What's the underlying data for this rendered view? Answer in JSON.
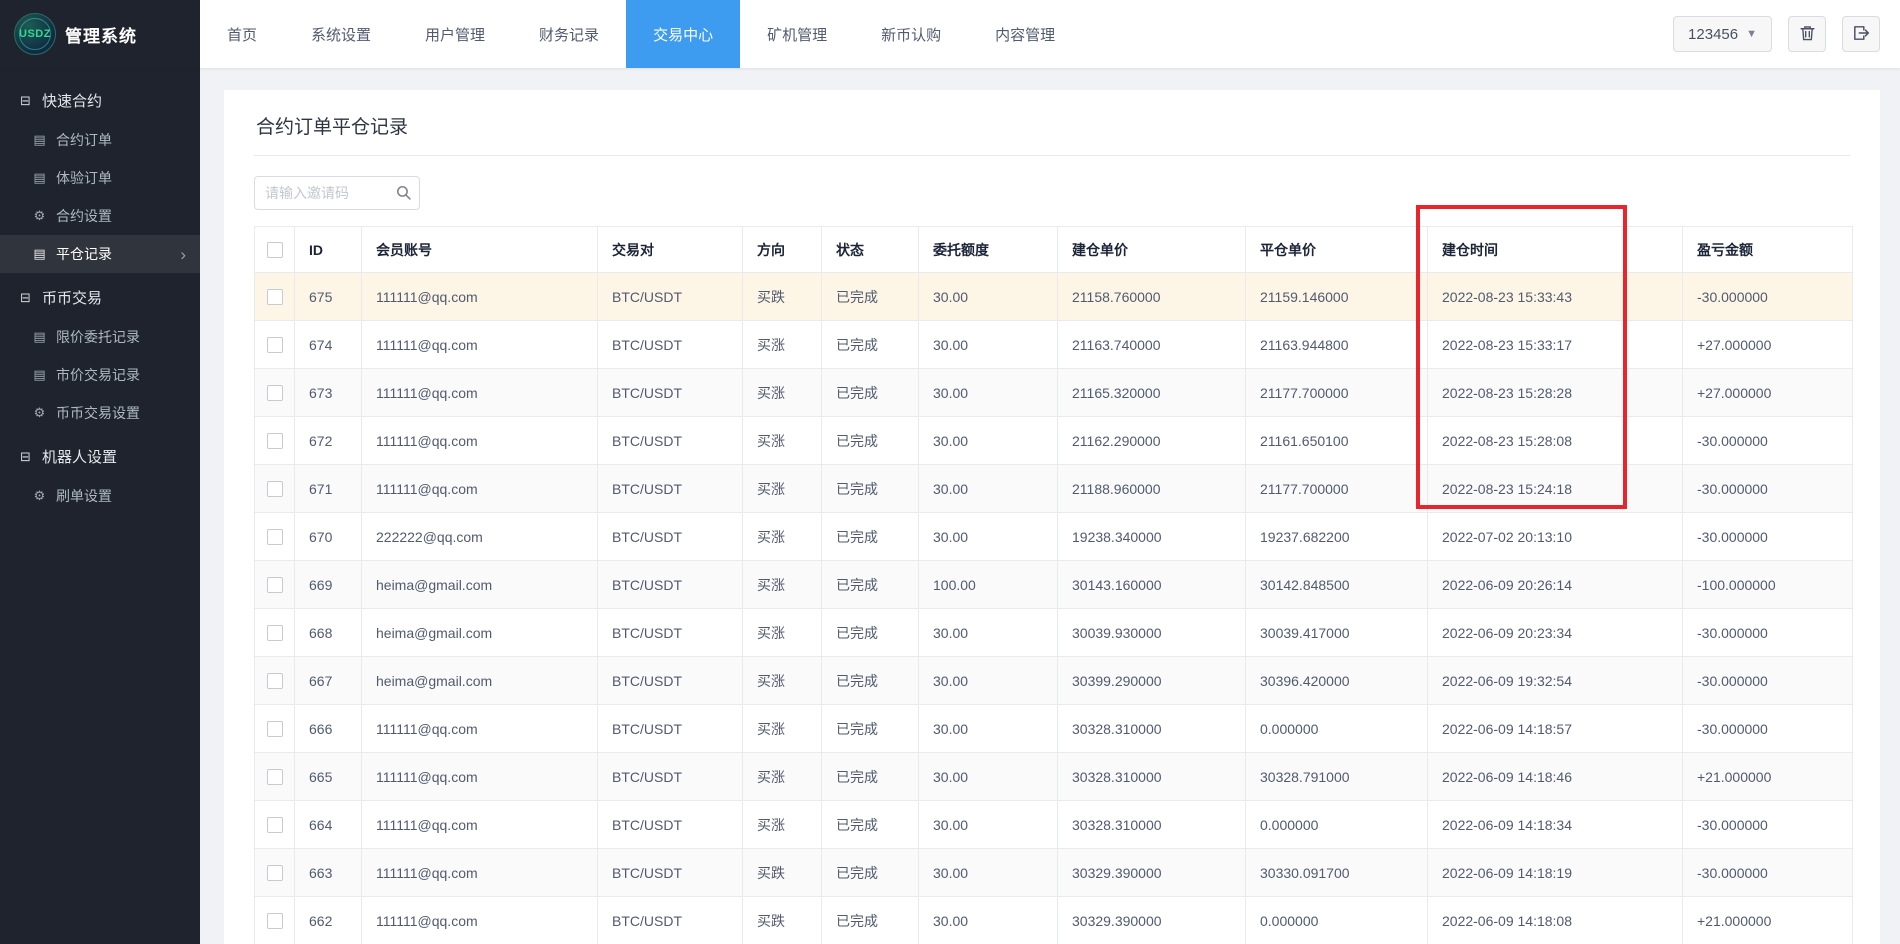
{
  "colors": {
    "accent": "#3d9bf0",
    "green": "#19be6b",
    "red": "#ed4014",
    "sidebar_bg": "#1f232d",
    "highlight_row": "#fdf6e7",
    "annotation": "#e8252c"
  },
  "brand": {
    "logo_text": "USDZ",
    "title": "管理系统"
  },
  "topnav": {
    "items": [
      {
        "label": "首页",
        "active": false
      },
      {
        "label": "系统设置",
        "active": false
      },
      {
        "label": "用户管理",
        "active": false
      },
      {
        "label": "财务记录",
        "active": false
      },
      {
        "label": "交易中心",
        "active": true
      },
      {
        "label": "矿机管理",
        "active": false
      },
      {
        "label": "新币认购",
        "active": false
      },
      {
        "label": "内容管理",
        "active": false
      }
    ],
    "user_dropdown": "123456"
  },
  "sidebar": {
    "sections": [
      {
        "title": "快速合约",
        "items": [
          {
            "label": "合约订单",
            "icon": "document-icon",
            "active": false
          },
          {
            "label": "体验订单",
            "icon": "document-icon",
            "active": false
          },
          {
            "label": "合约设置",
            "icon": "gear-icon",
            "active": false
          },
          {
            "label": "平仓记录",
            "icon": "document-icon",
            "active": true
          }
        ]
      },
      {
        "title": "币币交易",
        "items": [
          {
            "label": "限价委托记录",
            "icon": "document-icon",
            "active": false
          },
          {
            "label": "市价交易记录",
            "icon": "document-icon",
            "active": false
          },
          {
            "label": "币币交易设置",
            "icon": "gear-icon",
            "active": false
          }
        ]
      },
      {
        "title": "机器人设置",
        "items": [
          {
            "label": "刷单设置",
            "icon": "gear-icon",
            "active": false
          }
        ]
      }
    ]
  },
  "main": {
    "page_title": "合约订单平仓记录",
    "search_placeholder": "请输入邀请码",
    "table": {
      "columns": [
        "ID",
        "会员账号",
        "交易对",
        "方向",
        "状态",
        "委托额度",
        "建仓单价",
        "平仓单价",
        "建仓时间",
        "盈亏金额"
      ],
      "rows": [
        {
          "id": "675",
          "account": "111111@qq.com",
          "pair": "BTC/USDT",
          "direction": "买跌",
          "direction_color": "red",
          "status": "已完成",
          "amount": "30.00",
          "open_price": "21158.760000",
          "close_price": "21159.146000",
          "close_color": "red",
          "time": "2022-08-23 15:33:43",
          "pnl": "-30.000000",
          "pnl_color": "red",
          "highlight": true
        },
        {
          "id": "674",
          "account": "111111@qq.com",
          "pair": "BTC/USDT",
          "direction": "买涨",
          "direction_color": "green",
          "status": "已完成",
          "amount": "30.00",
          "open_price": "21163.740000",
          "close_price": "21163.944800",
          "close_color": "green",
          "time": "2022-08-23 15:33:17",
          "pnl": "+27.000000",
          "pnl_color": "green",
          "highlight": false
        },
        {
          "id": "673",
          "account": "111111@qq.com",
          "pair": "BTC/USDT",
          "direction": "买涨",
          "direction_color": "green",
          "status": "已完成",
          "amount": "30.00",
          "open_price": "21165.320000",
          "close_price": "21177.700000",
          "close_color": "green",
          "time": "2022-08-23 15:28:28",
          "pnl": "+27.000000",
          "pnl_color": "green",
          "highlight": false
        },
        {
          "id": "672",
          "account": "111111@qq.com",
          "pair": "BTC/USDT",
          "direction": "买涨",
          "direction_color": "green",
          "status": "已完成",
          "amount": "30.00",
          "open_price": "21162.290000",
          "close_price": "21161.650100",
          "close_color": "red",
          "time": "2022-08-23 15:28:08",
          "pnl": "-30.000000",
          "pnl_color": "red",
          "highlight": false
        },
        {
          "id": "671",
          "account": "111111@qq.com",
          "pair": "BTC/USDT",
          "direction": "买涨",
          "direction_color": "green",
          "status": "已完成",
          "amount": "30.00",
          "open_price": "21188.960000",
          "close_price": "21177.700000",
          "close_color": "red",
          "time": "2022-08-23 15:24:18",
          "pnl": "-30.000000",
          "pnl_color": "red",
          "highlight": false
        },
        {
          "id": "670",
          "account": "222222@qq.com",
          "pair": "BTC/USDT",
          "direction": "买涨",
          "direction_color": "green",
          "status": "已完成",
          "amount": "30.00",
          "open_price": "19238.340000",
          "close_price": "19237.682200",
          "close_color": "red",
          "time": "2022-07-02 20:13:10",
          "pnl": "-30.000000",
          "pnl_color": "red",
          "highlight": false
        },
        {
          "id": "669",
          "account": "heima@gmail.com",
          "pair": "BTC/USDT",
          "direction": "买涨",
          "direction_color": "green",
          "status": "已完成",
          "amount": "100.00",
          "open_price": "30143.160000",
          "close_price": "30142.848500",
          "close_color": "red",
          "time": "2022-06-09 20:26:14",
          "pnl": "-100.000000",
          "pnl_color": "red",
          "highlight": false
        },
        {
          "id": "668",
          "account": "heima@gmail.com",
          "pair": "BTC/USDT",
          "direction": "买涨",
          "direction_color": "green",
          "status": "已完成",
          "amount": "30.00",
          "open_price": "30039.930000",
          "close_price": "30039.417000",
          "close_color": "red",
          "time": "2022-06-09 20:23:34",
          "pnl": "-30.000000",
          "pnl_color": "red",
          "highlight": false
        },
        {
          "id": "667",
          "account": "heima@gmail.com",
          "pair": "BTC/USDT",
          "direction": "买涨",
          "direction_color": "green",
          "status": "已完成",
          "amount": "30.00",
          "open_price": "30399.290000",
          "close_price": "30396.420000",
          "close_color": "red",
          "time": "2022-06-09 19:32:54",
          "pnl": "-30.000000",
          "pnl_color": "red",
          "highlight": false
        },
        {
          "id": "666",
          "account": "111111@qq.com",
          "pair": "BTC/USDT",
          "direction": "买涨",
          "direction_color": "green",
          "status": "已完成",
          "amount": "30.00",
          "open_price": "30328.310000",
          "close_price": "0.000000",
          "close_color": "red",
          "time": "2022-06-09 14:18:57",
          "pnl": "-30.000000",
          "pnl_color": "red",
          "highlight": false
        },
        {
          "id": "665",
          "account": "111111@qq.com",
          "pair": "BTC/USDT",
          "direction": "买涨",
          "direction_color": "green",
          "status": "已完成",
          "amount": "30.00",
          "open_price": "30328.310000",
          "close_price": "30328.791000",
          "close_color": "green",
          "time": "2022-06-09 14:18:46",
          "pnl": "+21.000000",
          "pnl_color": "green",
          "highlight": false
        },
        {
          "id": "664",
          "account": "111111@qq.com",
          "pair": "BTC/USDT",
          "direction": "买涨",
          "direction_color": "green",
          "status": "已完成",
          "amount": "30.00",
          "open_price": "30328.310000",
          "close_price": "0.000000",
          "close_color": "red",
          "time": "2022-06-09 14:18:34",
          "pnl": "-30.000000",
          "pnl_color": "red",
          "highlight": false
        },
        {
          "id": "663",
          "account": "111111@qq.com",
          "pair": "BTC/USDT",
          "direction": "买跌",
          "direction_color": "red",
          "status": "已完成",
          "amount": "30.00",
          "open_price": "30329.390000",
          "close_price": "30330.091700",
          "close_color": "red",
          "time": "2022-06-09 14:18:19",
          "pnl": "-30.000000",
          "pnl_color": "red",
          "highlight": false
        },
        {
          "id": "662",
          "account": "111111@qq.com",
          "pair": "BTC/USDT",
          "direction": "买跌",
          "direction_color": "red",
          "status": "已完成",
          "amount": "30.00",
          "open_price": "30329.390000",
          "close_price": "0.000000",
          "close_color": "green",
          "time": "2022-06-09 14:18:08",
          "pnl": "+21.000000",
          "pnl_color": "green",
          "highlight": false
        }
      ]
    }
  }
}
